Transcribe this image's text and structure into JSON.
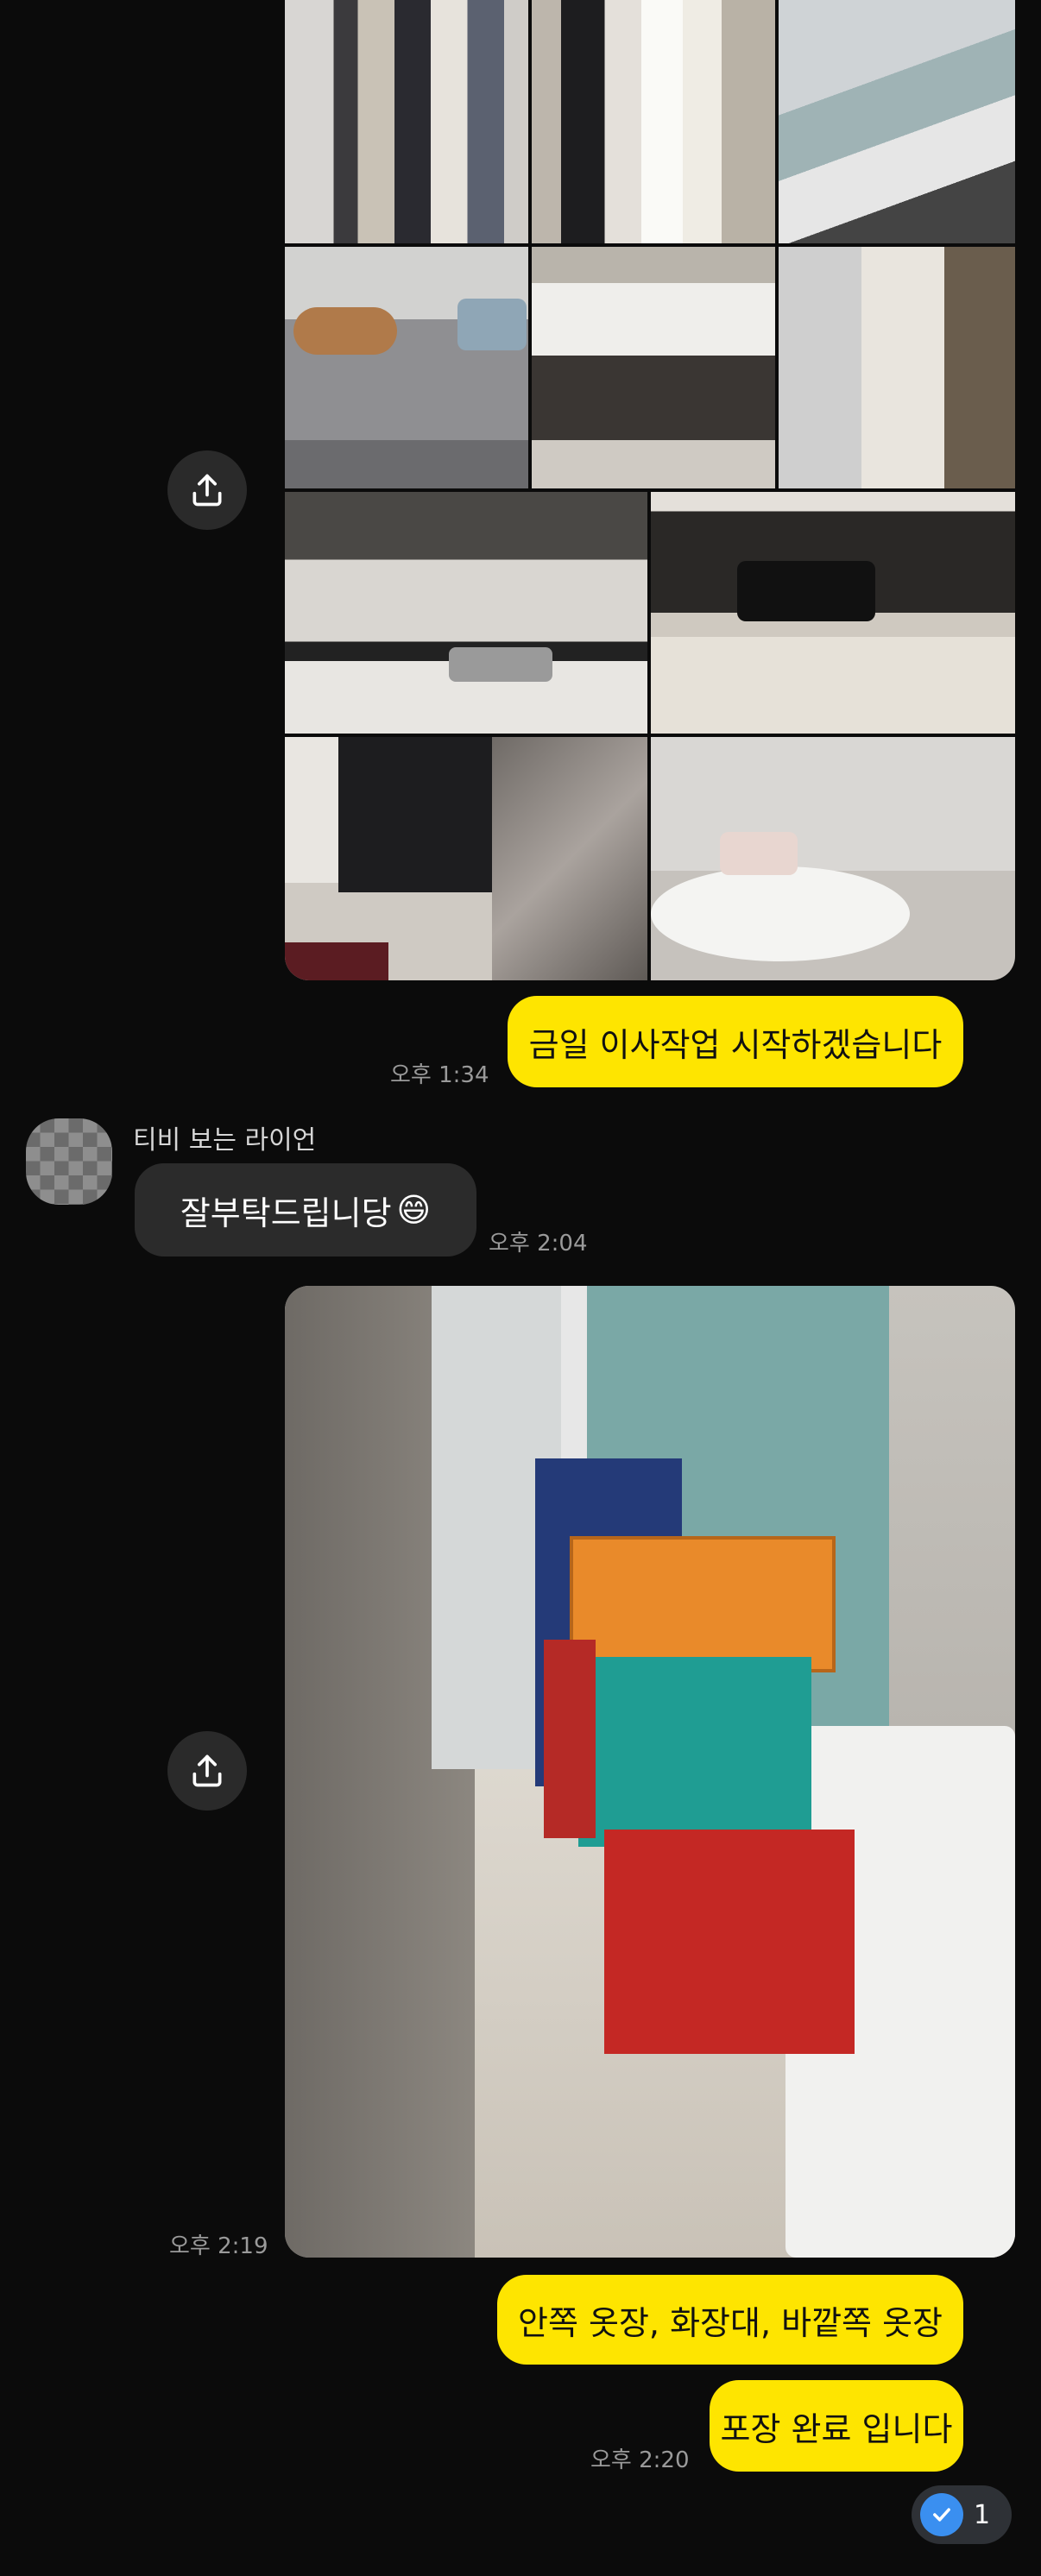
{
  "colors": {
    "my_bubble": "#fee500",
    "their_bubble": "#2b2b2b",
    "background": "#0b0b0b",
    "read_check": "#3a8ff0"
  },
  "messages": {
    "msg1": {
      "text": "금일 이사작업 시작하겠습니다",
      "time": "오후 1:34"
    },
    "msg2": {
      "sender": "티비 보는 라이언",
      "text": "잘부탁드립니당",
      "emoji": "😄",
      "time": "오후 2:04"
    },
    "photo2_time": "오후 2:19",
    "msg3": {
      "text": "안쪽 옷장, 화장대, 바깥쪽 옷장"
    },
    "msg4": {
      "text": "포장 완료 입니다",
      "time": "오후 2:20"
    }
  },
  "read_badge": {
    "icon": "check-circle-icon",
    "count": "1"
  },
  "icons": {
    "share": "share-icon"
  }
}
